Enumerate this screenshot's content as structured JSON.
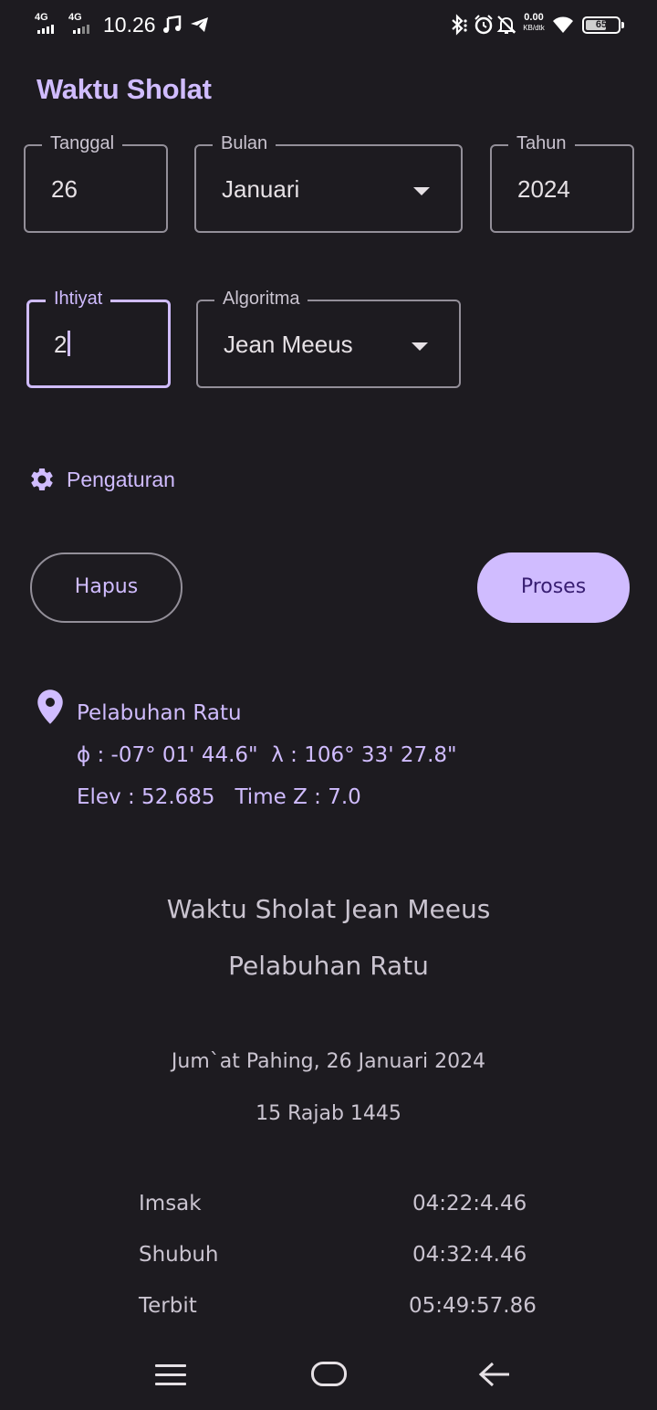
{
  "status_bar": {
    "network1": "4G",
    "network2": "4G",
    "time": "10.26",
    "speed_value": "0.00",
    "speed_unit": "KB/dtk",
    "battery": "65",
    "battery_level": 0.65,
    "icons": [
      "music-icon",
      "telegram-icon",
      "bluetooth-icon",
      "alarm-icon",
      "mute-icon",
      "wifi-icon",
      "battery-icon"
    ]
  },
  "header": {
    "title": "Waktu Sholat"
  },
  "form": {
    "tanggal": {
      "label": "Tanggal",
      "value": "26"
    },
    "bulan": {
      "label": "Bulan",
      "value": "Januari"
    },
    "tahun": {
      "label": "Tahun",
      "value": "2024"
    },
    "ihtiyat": {
      "label": "Ihtiyat",
      "value": "2"
    },
    "algoritma": {
      "label": "Algoritma",
      "value": "Jean Meeus"
    }
  },
  "settings": {
    "label": "Pengaturan",
    "icon": "gear-icon"
  },
  "buttons": {
    "hapus": "Hapus",
    "proses": "Proses"
  },
  "location": {
    "icon": "location-pin-icon",
    "name": "Pelabuhan Ratu",
    "coords": "ϕ : -07° 01' 44.6\"  λ : 106° 33' 27.8\"",
    "elev_tz": "Elev : 52.685   Time Z : 7.0"
  },
  "result": {
    "title": "Waktu Sholat Jean Meeus",
    "place": "Pelabuhan Ratu",
    "date_masehi": "Jum`at Pahing, 26 Januari 2024",
    "date_hijri": "15 Rajab 1445",
    "times": [
      {
        "name": "Imsak",
        "time": "04:22:4.46"
      },
      {
        "name": "Shubuh",
        "time": "04:32:4.46"
      },
      {
        "name": "Terbit",
        "time": "05:49:57.86"
      }
    ]
  },
  "nav_bar": {
    "icons": [
      "menu-icon",
      "home-icon",
      "back-icon"
    ]
  },
  "colors": {
    "background": "#1d1b20",
    "accent": "#d0bcff",
    "on_accent": "#381e72",
    "text": "#e6e1e5",
    "outline": "#938f99"
  }
}
